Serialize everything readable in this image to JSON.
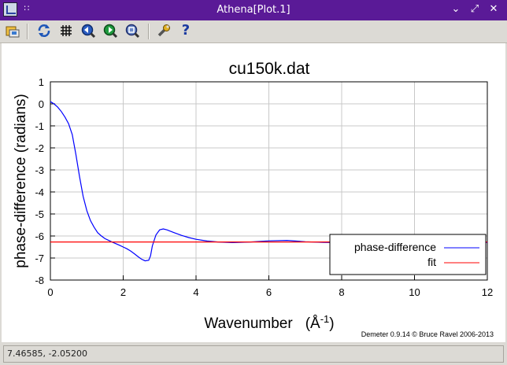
{
  "window": {
    "title": "Athena[Plot.1]",
    "menu_glyph": "∷",
    "minimize_glyph": "⌄",
    "maximize_glyph": "⤢",
    "close_glyph": "✕"
  },
  "toolbar": {
    "buttons": [
      {
        "icon": "save-image-icon"
      },
      {
        "icon": "refresh-icon"
      },
      {
        "icon": "grid-icon"
      },
      {
        "icon": "zoom-back-icon"
      },
      {
        "icon": "zoom-forward-icon"
      },
      {
        "icon": "zoom-reset-icon"
      },
      {
        "icon": "configure-icon"
      },
      {
        "icon": "help-icon"
      }
    ],
    "help_glyph": "?"
  },
  "chart_data": {
    "type": "line",
    "title": "cu150k.dat",
    "xlabel": "Wavenumber",
    "xlabel_unit": "(Å",
    "xlabel_sup": "-1",
    "xlabel_close": ")",
    "ylabel": "phase-difference    (radians)",
    "xlim": [
      0,
      12
    ],
    "ylim": [
      -8,
      1
    ],
    "xticks": [
      0,
      2,
      4,
      6,
      8,
      10,
      12
    ],
    "yticks": [
      1,
      0,
      -1,
      -2,
      -3,
      -4,
      -5,
      -6,
      -7,
      -8
    ],
    "grid": true,
    "legend_placement": "bottom-right",
    "series": [
      {
        "name": "phase-difference",
        "color": "#0000ff",
        "x": [
          0.0,
          0.1,
          0.2,
          0.3,
          0.4,
          0.5,
          0.6,
          0.7,
          0.8,
          0.9,
          1.0,
          1.1,
          1.2,
          1.3,
          1.4,
          1.5,
          1.6,
          1.7,
          1.8,
          1.9,
          2.0,
          2.1,
          2.2,
          2.3,
          2.4,
          2.5,
          2.6,
          2.7,
          2.75,
          2.8,
          2.9,
          3.0,
          3.1,
          3.2,
          3.4,
          3.6,
          3.8,
          4.0,
          4.3,
          4.6,
          5.0,
          5.5,
          6.0,
          6.5,
          7.0,
          7.5,
          8.0,
          8.5,
          9.0,
          9.5,
          10.0,
          10.5,
          11.0,
          11.3,
          11.6,
          12.0
        ],
        "y": [
          0.1,
          0.0,
          -0.15,
          -0.35,
          -0.6,
          -0.9,
          -1.4,
          -2.3,
          -3.3,
          -4.2,
          -4.85,
          -5.3,
          -5.6,
          -5.85,
          -6.0,
          -6.12,
          -6.2,
          -6.28,
          -6.35,
          -6.42,
          -6.5,
          -6.58,
          -6.68,
          -6.8,
          -6.93,
          -7.05,
          -7.13,
          -7.1,
          -6.9,
          -6.45,
          -5.95,
          -5.72,
          -5.68,
          -5.72,
          -5.85,
          -5.97,
          -6.07,
          -6.15,
          -6.23,
          -6.27,
          -6.3,
          -6.27,
          -6.22,
          -6.2,
          -6.26,
          -6.29,
          -6.3,
          -6.26,
          -6.22,
          -6.24,
          -6.28,
          -6.24,
          -6.15,
          -6.08,
          -6.12,
          -6.3
        ]
      },
      {
        "name": "fit",
        "color": "#ff0000",
        "x": [
          0,
          12
        ],
        "y": [
          -6.27,
          -6.27
        ]
      }
    ]
  },
  "footer": {
    "credit": "Demeter 0.9.14 © Bruce Ravel 2006-2013"
  },
  "status": {
    "coordinates": "7.46585, -2.05200"
  }
}
